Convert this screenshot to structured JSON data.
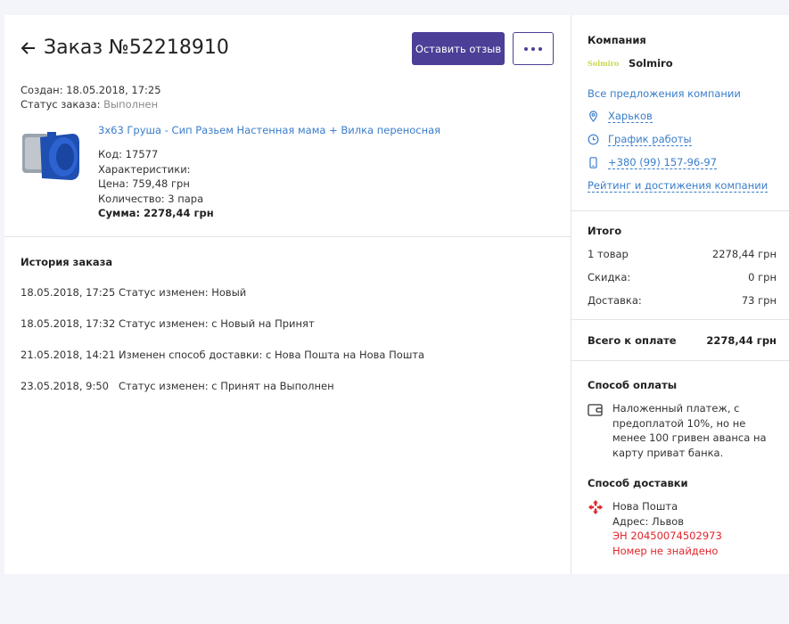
{
  "order": {
    "title": "Заказ №52218910",
    "review_button": "Оставить отзыв",
    "created": "Создан: 18.05.2018, 17:25",
    "status_label": "Статус заказа:",
    "status_value": "Выполнен"
  },
  "product": {
    "name": "3х63 Груша - Сип Разьем Настенная мама + Вилка переносная",
    "code": "Код: 17577",
    "characteristics": "Характеристики:",
    "price": "Цена: 759,48 грн",
    "quantity": "Количество: 3 пара",
    "sum": "Сумма: 2278,44 грн"
  },
  "history": {
    "title": "История заказа",
    "rows": [
      {
        "date": "18.05.2018, 17:25",
        "text": "Статус изменен: Новый"
      },
      {
        "date": "18.05.2018, 17:32",
        "text": "Статус изменен: с Новый на Принят"
      },
      {
        "date": "21.05.2018, 14:21",
        "text": "Изменен способ доставки: с Нова Пошта на Нова Пошта"
      },
      {
        "date": "23.05.2018, 9:50",
        "text": "Статус изменен: с Принят на Выполнен"
      }
    ]
  },
  "company": {
    "section_title": "Компания",
    "logo_text": "Solmiro",
    "name": "Solmiro",
    "all_offers": "Все предложения компании",
    "city": "Харьков",
    "schedule": "График работы",
    "phone": "+380 (99) 157-96-97",
    "rating": "Рейтинг и достижения компании"
  },
  "totals": {
    "title": "Итого",
    "items_label": "1 товар",
    "items_value": "2278,44 грн",
    "discount_label": "Скидка:",
    "discount_value": "0 грн",
    "delivery_label": "Доставка:",
    "delivery_value": "73 грн",
    "total_label": "Всего к оплате",
    "total_value": "2278,44 грн"
  },
  "payment": {
    "title": "Способ оплаты",
    "text": "Наложенный платеж, с предоплатой 10%, но не менее 100 гривен аванса на карту приват банка."
  },
  "delivery": {
    "title": "Способ доставки",
    "carrier": "Нова Пошта",
    "address": "Адрес: Львов",
    "ttn": "ЭН 20450074502973",
    "ttn_status": "Номер не знайдено"
  },
  "colors": {
    "accent": "#4b3f97",
    "link": "#3a7dc9",
    "error": "#e0252b"
  }
}
